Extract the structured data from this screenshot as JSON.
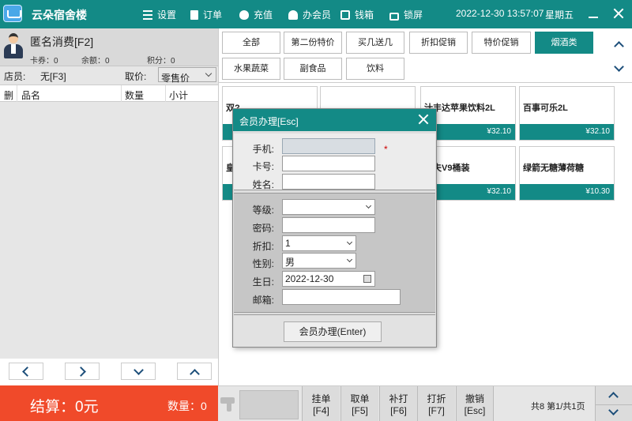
{
  "app": {
    "title": "云朵宿舍楼"
  },
  "topmenu": [
    {
      "label": "设置",
      "icon": "settings-icon"
    },
    {
      "label": "订单",
      "icon": "order-icon"
    },
    {
      "label": "充值",
      "icon": "money-bag-icon"
    },
    {
      "label": "办会员",
      "icon": "member-icon"
    },
    {
      "label": "钱箱",
      "icon": "cash-drawer-icon"
    },
    {
      "label": "锁屏",
      "icon": "lock-icon"
    }
  ],
  "clock": {
    "datetime": "2022-12-30 13:57:07",
    "weekday": "星期五"
  },
  "customer": {
    "name": "匿名消费[F2]",
    "coupon_label": "卡券：0",
    "balance_label": "余额：0",
    "points_label": "积分：0"
  },
  "staff": {
    "label": "店员:",
    "value": "无[F3]",
    "price_label": "取价:",
    "price_value": "零售价"
  },
  "cart_table": {
    "columns": [
      "删",
      "品名",
      "数量",
      "小计"
    ]
  },
  "categories": [
    "全部",
    "第二份特价",
    "买几送几",
    "折扣促销",
    "特价促销",
    "烟酒类",
    "水果蔬菜",
    "副食品",
    "饮料"
  ],
  "active_category": "烟酒类",
  "products": [
    {
      "name": "双?",
      "price": ""
    },
    {
      "name": "",
      "price": ""
    },
    {
      "name": "汁丰达苹果饮料2L",
      "price": "¥32.10"
    },
    {
      "name": "百事可乐2L",
      "price": "¥32.10"
    },
    {
      "name": "皇",
      "price": ""
    },
    {
      "name": "",
      "price": ""
    },
    {
      "name": "农夫V9桶装",
      "price": "¥32.10"
    },
    {
      "name": "绿箭无糖薄荷糖",
      "price": "¥10.30"
    }
  ],
  "modal": {
    "title": "会员办理[Esc]",
    "fields": {
      "phone": {
        "label": "手机:",
        "value": "",
        "required_mark": "*"
      },
      "card": {
        "label": "卡号:",
        "value": ""
      },
      "name": {
        "label": "姓名:",
        "value": ""
      },
      "level": {
        "label": "等级:",
        "value": ""
      },
      "password": {
        "label": "密码:",
        "value": ""
      },
      "discount": {
        "label": "折扣:",
        "value": "1"
      },
      "gender": {
        "label": "性别:",
        "value": "男"
      },
      "birthday": {
        "label": "生日:",
        "value": "2022-12-30"
      },
      "email": {
        "label": "邮箱:",
        "value": ""
      }
    },
    "submit_label": "会员办理(Enter)"
  },
  "checkout": {
    "total_label": "结算：0元",
    "qty_label": "数量：0"
  },
  "function_buttons": [
    {
      "line1": "挂单",
      "line2": "[F4]"
    },
    {
      "line1": "取单",
      "line2": "[F5]"
    },
    {
      "line1": "补打",
      "line2": "[F6]"
    },
    {
      "line1": "打折",
      "line2": "[F7]"
    },
    {
      "line1": "撤销",
      "line2": "[Esc]"
    }
  ],
  "pagination": {
    "text": "共8 第1/共1页"
  },
  "colors": {
    "accent": "#138a86",
    "checkout": "#f04a2a"
  }
}
